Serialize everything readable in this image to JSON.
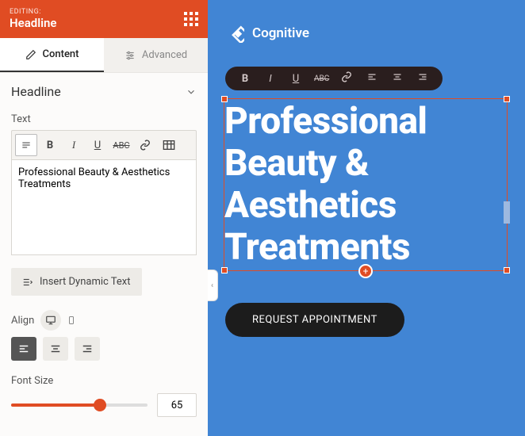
{
  "panel": {
    "editing_label": "EDITING:",
    "editing_title": "Headline",
    "tabs": {
      "content": "Content",
      "advanced": "Advanced"
    },
    "section_title": "Headline",
    "text_label": "Text",
    "textarea_value": "Professional Beauty & Aesthetics Treatments",
    "insert_dynamic": "Insert Dynamic Text",
    "align_label": "Align",
    "fontsize_label": "Font Size",
    "fontsize_value": "65"
  },
  "preview": {
    "logo_text": "Cognitive",
    "headline": "Professional Beauty & Aesthetics Treatments",
    "cta": "REQUEST APPOINTMENT"
  },
  "colors": {
    "accent": "#e04c23",
    "preview_bg": "#4185d4"
  }
}
